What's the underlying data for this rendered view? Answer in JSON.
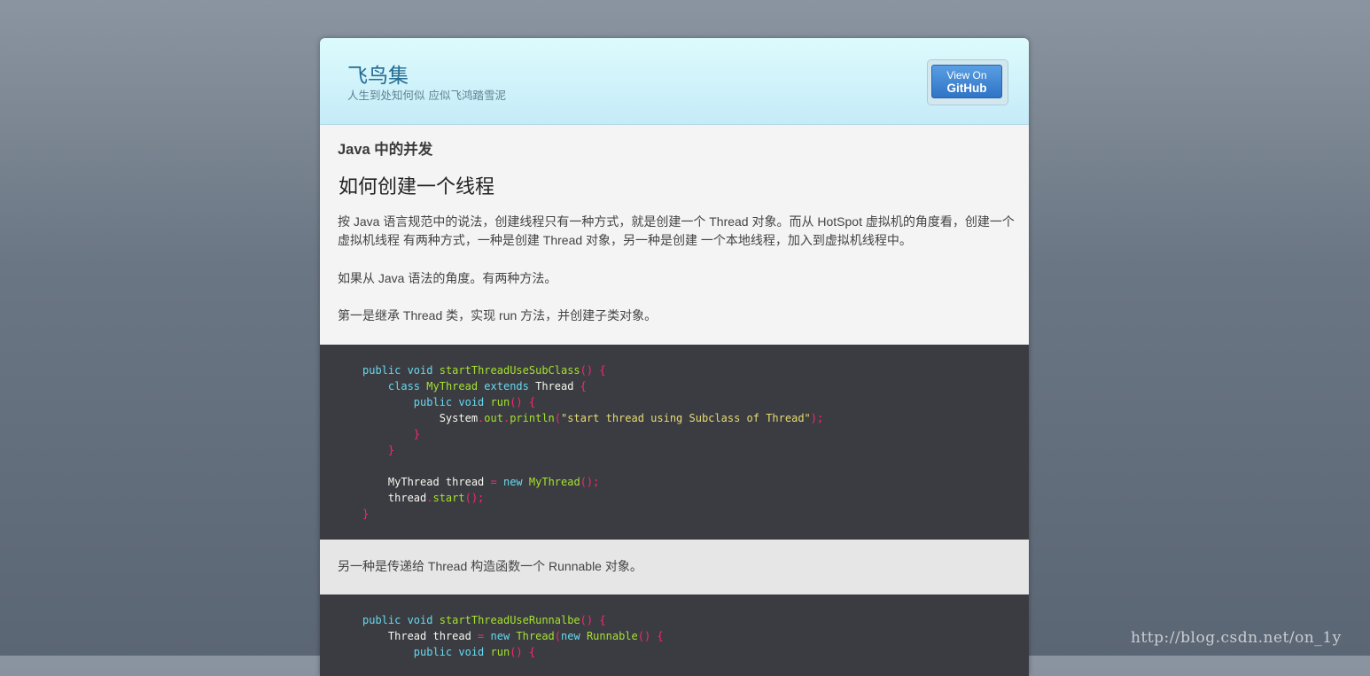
{
  "header": {
    "site_title": "飞鸟集",
    "tagline": "人生到处知何似 应似飞鸿踏雪泥",
    "github_small": "View On",
    "github_big": "GitHub"
  },
  "post": {
    "title": "Java 中的并发",
    "section_heading": "如何创建一个线程",
    "paragraphs": [
      "按 Java 语言规范中的说法，创建线程只有一种方式，就是创建一个 Thread 对象。而从 HotSpot 虚拟机的角度看，创建一个虚拟机线程 有两种方式，一种是创建 Thread 对象，另一种是创建 一个本地线程，加入到虚拟机线程中。",
      "如果从 Java 语法的角度。有两种方法。",
      "第一是继承 Thread 类，实现 run 方法，并创建子类对象。",
      "另一种是传递给 Thread 构造函数一个 Runnable 对象。"
    ],
    "code_blocks": [
      [
        "public void startThreadUseSubClass() {",
        "    class MyThread extends Thread {",
        "        public void run() {",
        "            System.out.println(\"start thread using Subclass of Thread\");",
        "        }",
        "    }",
        "",
        "    MyThread thread = new MyThread();",
        "    thread.start();",
        "}"
      ],
      [
        "public void startThreadUseRunnalbe() {",
        "    Thread thread = new Thread(new Runnable() {",
        "        public void run() {"
      ]
    ]
  },
  "watermark": "http://blog.csdn.net/on_1y"
}
